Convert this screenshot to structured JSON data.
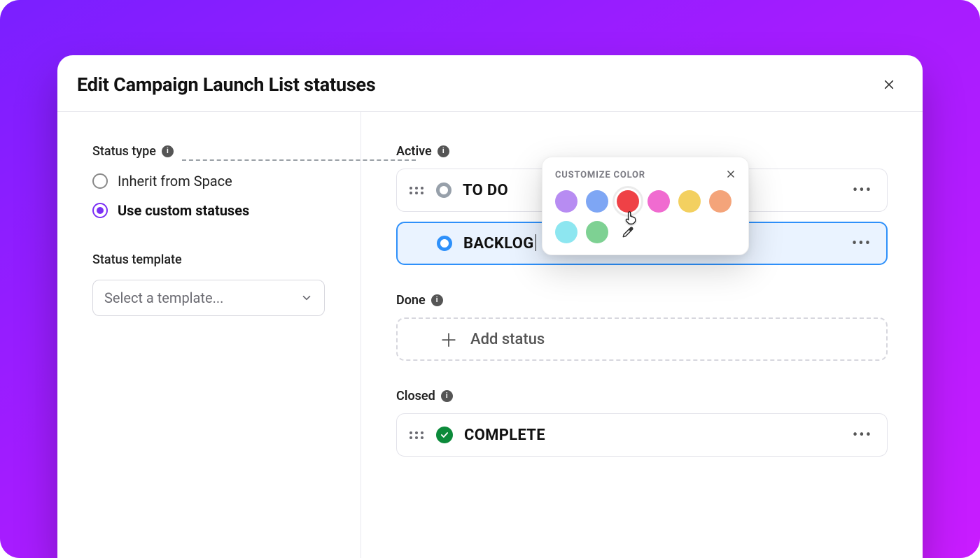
{
  "modal": {
    "title": "Edit Campaign Launch List statuses"
  },
  "left": {
    "status_type_label": "Status type",
    "radios": {
      "inherit": "Inherit from Space",
      "custom": "Use custom statuses"
    },
    "template_label": "Status template",
    "template_placeholder": "Select a template..."
  },
  "sections": {
    "active_label": "Active",
    "done_label": "Done",
    "closed_label": "Closed",
    "add_status_label": "Add status"
  },
  "statuses": {
    "todo": "TO DO",
    "backlog": "BACKLOG",
    "complete": "COMPLETE"
  },
  "popover": {
    "title": "CUSTOMIZE COLOR",
    "colors": {
      "purple": "#b78cf2",
      "blue": "#7ea6f4",
      "red": "#ef4146",
      "pink": "#f06bd0",
      "yellow": "#f3d060",
      "orange": "#f4a47a",
      "cyan": "#8de6f0",
      "green": "#7ed193"
    },
    "selected": "red"
  }
}
